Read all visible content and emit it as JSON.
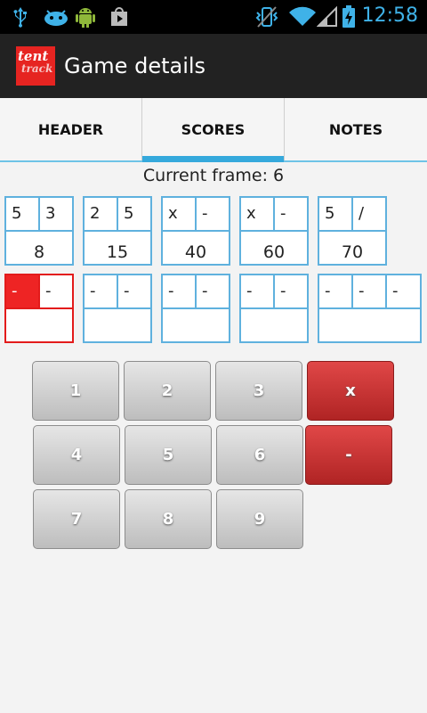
{
  "status_bar": {
    "time": "12:58",
    "icons": [
      "usb-icon",
      "android-debug-icon",
      "android-icon",
      "play-store-icon",
      "vibrate-icon",
      "wifi-icon",
      "signal-icon",
      "battery-charging-icon"
    ]
  },
  "action_bar": {
    "logo_line1": "tent",
    "logo_line2": "track",
    "title": "Game details"
  },
  "tabs": [
    {
      "label": "HEADER",
      "selected": false
    },
    {
      "label": "SCORES",
      "selected": true
    },
    {
      "label": "NOTES",
      "selected": false
    }
  ],
  "current_frame_label": "Current frame: 6",
  "frames": [
    {
      "rolls": [
        "5",
        "3"
      ],
      "total": "8"
    },
    {
      "rolls": [
        "2",
        "5"
      ],
      "total": "15"
    },
    {
      "rolls": [
        "x",
        "-"
      ],
      "total": "40"
    },
    {
      "rolls": [
        "x",
        "-"
      ],
      "total": "60"
    },
    {
      "rolls": [
        "5",
        "/"
      ],
      "total": "70"
    },
    {
      "rolls": [
        "-",
        "-"
      ],
      "total": ""
    },
    {
      "rolls": [
        "-",
        "-"
      ],
      "total": ""
    },
    {
      "rolls": [
        "-",
        "-"
      ],
      "total": ""
    },
    {
      "rolls": [
        "-",
        "-"
      ],
      "total": ""
    },
    {
      "rolls": [
        "-",
        "-",
        "-"
      ],
      "total": ""
    }
  ],
  "keypad": {
    "digits": [
      "1",
      "2",
      "3",
      "4",
      "5",
      "6",
      "7",
      "8",
      "9"
    ],
    "strike": "x",
    "miss": "-"
  },
  "colors": {
    "accent": "#35a9dc",
    "frame_border": "#5fb1de",
    "active_red": "#ee2424",
    "key_red": "#c53232",
    "key_gray": "#cfcfcf"
  }
}
